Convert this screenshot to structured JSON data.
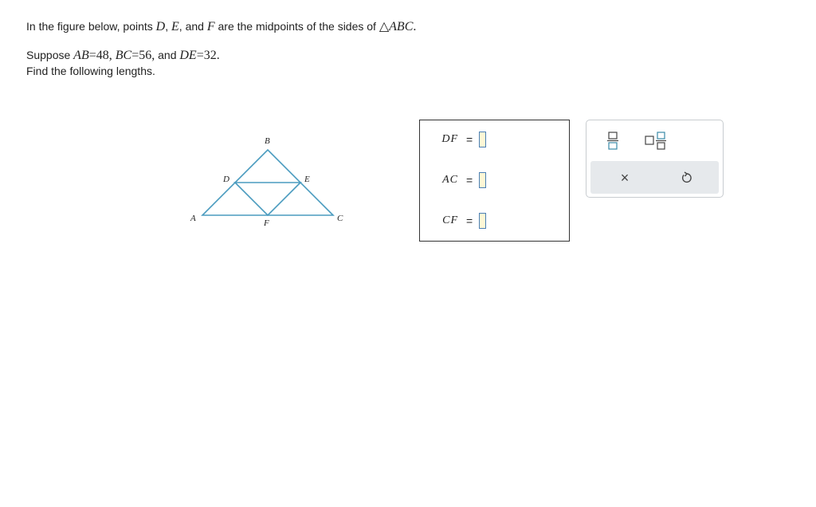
{
  "question": {
    "l1_pre": "In the figure below, points ",
    "l1_D": "D",
    "l1_c1": ", ",
    "l1_E": "E",
    "l1_c2": ", and ",
    "l1_F": "F",
    "l1_post": " are the midpoints of the sides of ",
    "l1_tri": "△",
    "l1_abc": "ABC",
    "l1_dot": ".",
    "l2_pre": "Suppose ",
    "l2_ab": "AB",
    "l2_ab_val": "=48, ",
    "l2_bc": "BC",
    "l2_bc_val": "=56,",
    "l2_and": " and ",
    "l2_de": "DE",
    "l2_de_val": "=32.",
    "l3": "Find the following lengths."
  },
  "figure": {
    "labels": {
      "A": "A",
      "B": "B",
      "C": "C",
      "D": "D",
      "E": "E",
      "F": "F"
    },
    "stroke_color": "#4a9bbf"
  },
  "answers": [
    {
      "label": "DF",
      "eq": "=",
      "value": ""
    },
    {
      "label": "AC",
      "eq": "=",
      "value": ""
    },
    {
      "label": "CF",
      "eq": "=",
      "value": ""
    }
  ],
  "tools": {
    "fraction": "fraction-icon",
    "mixed_number": "mixed-number-icon",
    "clear": "×",
    "undo": "undo-icon"
  },
  "colors": {
    "input_fill": "#fff7d6",
    "input_border": "#4a7fb5",
    "toolbar_bg": "#e6e9ec",
    "icon_teal": "#3a8aa8"
  }
}
